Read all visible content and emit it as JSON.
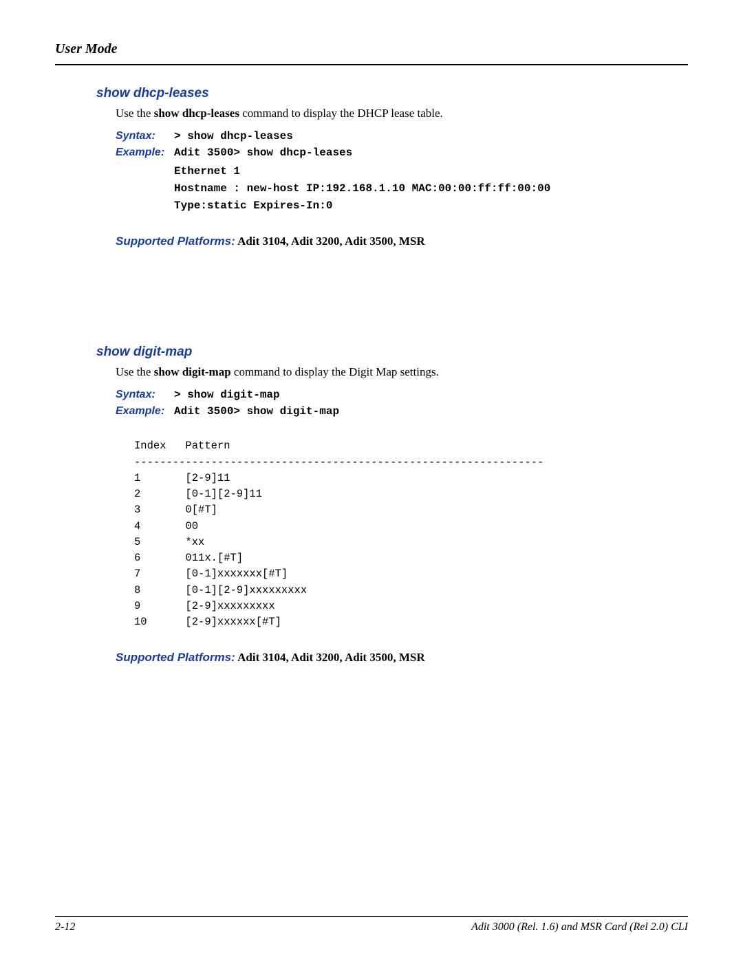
{
  "header": {
    "title": "User Mode"
  },
  "sections": {
    "dhcp": {
      "title": "show dhcp-leases",
      "desc_pre": "Use the ",
      "desc_cmd": "show dhcp-leases",
      "desc_post": " command to display the DHCP lease table.",
      "syntax_label": "Syntax:",
      "syntax_cmd": "> show dhcp-leases",
      "example_label": "Example:",
      "example_cmd": "Adit 3500> show dhcp-leases",
      "output": "Ethernet 1\nHostname : new-host IP:192.168.1.10 MAC:00:00:ff:ff:00:00\nType:static Expires-In:0",
      "supported_label": "Supported Platforms:",
      "supported_val": "  Adit 3104, Adit 3200, Adit 3500, MSR"
    },
    "digitmap": {
      "title": "show digit-map",
      "desc_pre": "Use the ",
      "desc_cmd": "show digit-map",
      "desc_post": " command to display the Digit Map settings.",
      "syntax_label": "Syntax:",
      "syntax_cmd": "> show digit-map",
      "example_label": "Example:",
      "example_cmd": "Adit 3500> show digit-map",
      "table": "Index   Pattern\n----------------------------------------------------------------\n1       [2-9]11\n2       [0-1][2-9]11\n3       0[#T]\n4       00\n5       *xx\n6       011x.[#T]\n7       [0-1]xxxxxxx[#T]\n8       [0-1][2-9]xxxxxxxxx\n9       [2-9]xxxxxxxxx\n10      [2-9]xxxxxx[#T]",
      "supported_label": "Supported Platforms:",
      "supported_val": "  Adit 3104, Adit 3200, Adit 3500, MSR"
    }
  },
  "footer": {
    "page": "2-12",
    "doc": "Adit 3000 (Rel. 1.6) and MSR Card (Rel 2.0) CLI"
  }
}
